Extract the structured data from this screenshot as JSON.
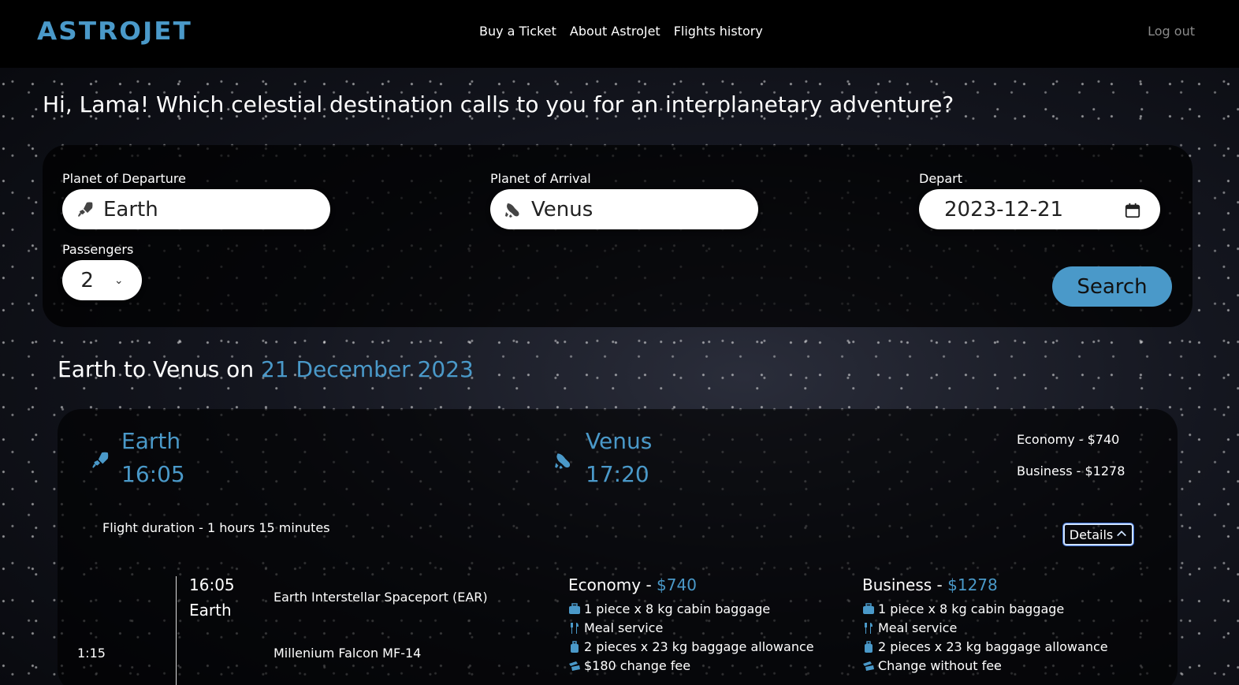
{
  "header": {
    "logo": "ASTROJET",
    "nav": [
      "Buy a Ticket",
      "About AstroJet",
      "Flights history"
    ],
    "logout": "Log out"
  },
  "greeting": "Hi, Lama! Which celestial destination calls to you for an interplanetary adventure?",
  "search": {
    "departure_label": "Planet of Departure",
    "departure_value": "Earth",
    "arrival_label": "Planet of Arrival",
    "arrival_value": "Venus",
    "depart_label": "Depart",
    "depart_value": "2023-12-21",
    "passengers_label": "Passengers",
    "passengers_value": "2",
    "search_button": "Search"
  },
  "results": {
    "route_prefix": "Earth to Venus on ",
    "route_date": "21 December 2023"
  },
  "flight": {
    "from_planet": "Earth",
    "from_time": "16:05",
    "to_planet": "Venus",
    "to_time": "17:20",
    "economy_price_short": "Economy - $740",
    "business_price_short": "Business - $1278",
    "duration": "Flight duration - 1 hours 15 minutes",
    "details_button": "Details",
    "segment": {
      "dep_time": "16:05",
      "dep_planet": "Earth",
      "spaceport": "Earth Interstellar Spaceport (EAR)",
      "leg_duration": "1:15",
      "craft": "Millenium Falcon MF-14"
    },
    "economy": {
      "title": "Economy - ",
      "price": "$740",
      "features": [
        "1 piece x 8 kg cabin baggage",
        "Meal service",
        "2 pieces x 23 kg baggage allowance",
        "$180 change fee"
      ]
    },
    "business": {
      "title": "Business - ",
      "price": "$1278",
      "features": [
        "1 piece x 8 kg cabin baggage",
        "Meal service",
        "2 pieces x 23 kg baggage allowance",
        "Change without fee"
      ]
    }
  },
  "colors": {
    "accent": "#4a99c9",
    "topbar": "#000000"
  }
}
